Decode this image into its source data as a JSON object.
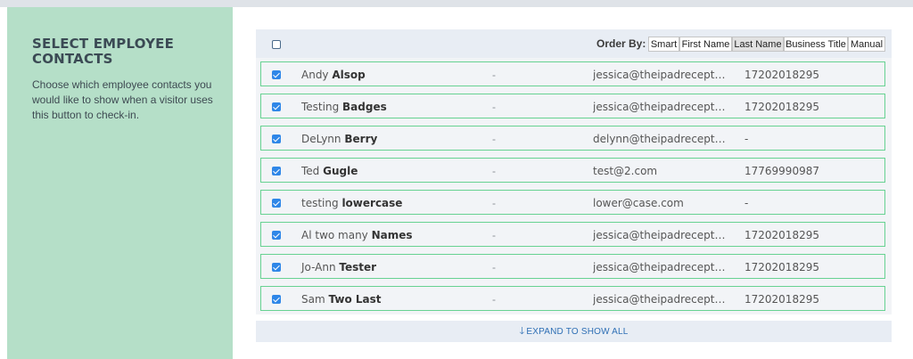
{
  "sidebar": {
    "title": "SELECT EMPLOYEE CONTACTS",
    "description": "Choose which employee contacts you would like to show when a visitor uses this button to check-in."
  },
  "header": {
    "order_by_label": "Order By:",
    "sort_options": [
      "Smart",
      "First Name",
      "Last Name",
      "Business Title",
      "Manual"
    ],
    "active_sort": "Last Name"
  },
  "contacts": [
    {
      "first": "Andy",
      "last": "Alsop",
      "title": "-",
      "email": "jessica@theipadreceptionist.com",
      "phone": "17202018295",
      "checked": true
    },
    {
      "first": "Testing",
      "last": "Badges",
      "title": "-",
      "email": "jessica@theipadreceptionist.com",
      "phone": "17202018295",
      "checked": true
    },
    {
      "first": "DeLynn",
      "last": "Berry",
      "title": "-",
      "email": "delynn@theipadreceptionist.com",
      "phone": "-",
      "checked": true
    },
    {
      "first": "Ted",
      "last": "Gugle",
      "title": "-",
      "email": "test@2.com",
      "phone": "17769990987",
      "checked": true
    },
    {
      "first": "testing",
      "last": "lowercase",
      "title": "-",
      "email": "lower@case.com",
      "phone": "-",
      "checked": true
    },
    {
      "first": "Al two many",
      "last": "Names",
      "title": "-",
      "email": "jessica@theipadreceptionist.com",
      "phone": "17202018295",
      "checked": true
    },
    {
      "first": "Jo-Ann",
      "last": "Tester",
      "title": "-",
      "email": "jessica@theipadreceptionist.com",
      "phone": "17202018295",
      "checked": true
    },
    {
      "first": "Sam",
      "last": "Two Last",
      "title": "-",
      "email": "jessica@theipadreceptionist.com",
      "phone": "17202018295",
      "checked": true
    }
  ],
  "expand_label": "EXPAND TO SHOW ALL",
  "colors": {
    "sidebar_bg": "#b5dfc8",
    "row_border": "#67d292",
    "checkbox": "#2f87e8",
    "link": "#2e6fb5"
  }
}
